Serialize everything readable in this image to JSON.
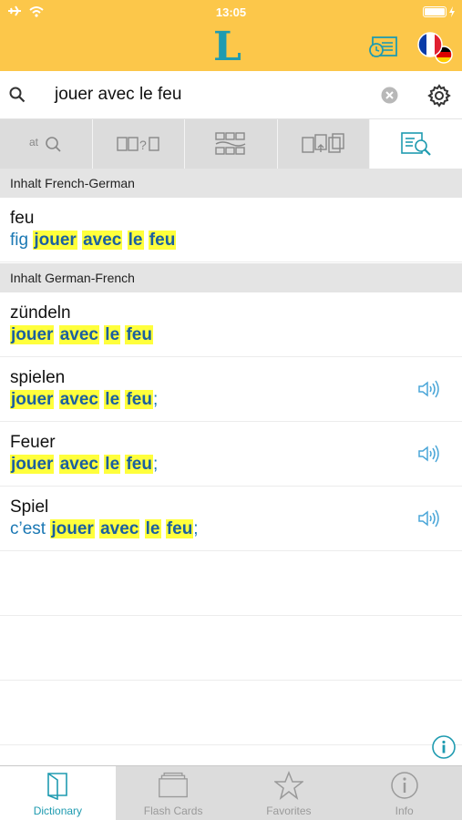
{
  "status_bar": {
    "time": "13:05"
  },
  "header": {
    "logo": "L",
    "colors": {
      "background": "#fcc74a",
      "accent": "#1f9bb0"
    }
  },
  "search": {
    "value": "jouer avec le feu"
  },
  "mode_tabs": [
    {
      "icon": "alphabet-search-icon",
      "label": "at"
    },
    {
      "icon": "word-guess-icon",
      "label": "?"
    },
    {
      "icon": "grid-puzzle-icon"
    },
    {
      "icon": "card-swap-icon"
    },
    {
      "icon": "fulltext-search-icon",
      "active": true
    }
  ],
  "sections": [
    {
      "title": "Inhalt French-German",
      "entries": [
        {
          "headword": "feu",
          "prefix": "fig",
          "highlights": [
            "jouer",
            "avec",
            "le",
            "feu"
          ],
          "suffix": "",
          "has_audio": false
        }
      ]
    },
    {
      "title": "Inhalt German-French",
      "entries": [
        {
          "headword": "zündeln",
          "prefix": "",
          "highlights": [
            "jouer",
            "avec",
            "le",
            "feu"
          ],
          "suffix": "",
          "has_audio": false
        },
        {
          "headword": "spielen",
          "prefix": "",
          "highlights": [
            "jouer",
            "avec",
            "le",
            "feu"
          ],
          "suffix": ";",
          "has_audio": true
        },
        {
          "headword": "Feuer",
          "prefix": "",
          "highlights": [
            "jouer",
            "avec",
            "le",
            "feu"
          ],
          "suffix": ";",
          "has_audio": true
        },
        {
          "headword": "Spiel",
          "prefix": "c’est",
          "highlights": [
            "jouer",
            "avec",
            "le",
            "feu"
          ],
          "suffix": ";",
          "has_audio": true
        }
      ]
    }
  ],
  "tab_bar": [
    {
      "label": "Dictionary",
      "icon": "book-icon",
      "active": true
    },
    {
      "label": "Flash Cards",
      "icon": "flash-cards-icon",
      "active": false
    },
    {
      "label": "Favorites",
      "icon": "star-icon",
      "active": false
    },
    {
      "label": "Info",
      "icon": "info-icon",
      "active": false
    }
  ]
}
